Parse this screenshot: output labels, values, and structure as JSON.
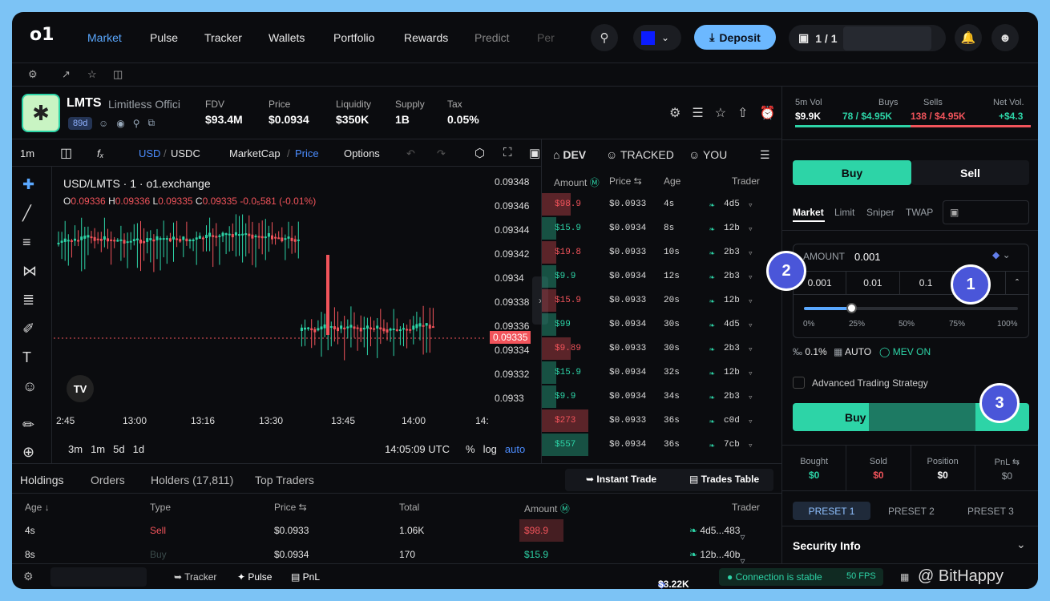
{
  "nav": {
    "logo": "o1",
    "items": [
      "Market",
      "Pulse",
      "Tracker",
      "Wallets",
      "Portfolio",
      "Rewards",
      "Predict",
      "Per"
    ],
    "deposit": "Deposit",
    "wallet": "1 / 1"
  },
  "token": {
    "ticker": "LMTS",
    "name": "Limitless Offici",
    "age": "89d",
    "fdv_label": "FDV",
    "fdv": "$93.4M",
    "price_label": "Price",
    "price": "$0.0934",
    "liq_label": "Liquidity",
    "liq": "$350K",
    "supply_label": "Supply",
    "supply": "1B",
    "tax_label": "Tax",
    "tax": "0.05%"
  },
  "chart_toolbar": {
    "interval": "1m",
    "usd": "USD",
    "usdc": "USDC",
    "marketcap": "MarketCap",
    "price": "Price",
    "options": "Options"
  },
  "chart": {
    "title": "USD/LMTS · 1 · o1.exchange",
    "ohlc": "O0.09336 H0.09336 L0.09335 C0.09335 -0.0₅581 (-0.01%)",
    "o_label": "O",
    "o": "0.09336",
    "h_label": "H",
    "h": "0.09336",
    "l_label": "L",
    "l": "0.09335",
    "c_label": "C",
    "c": "0.09335",
    "chg": "-0.0₅581 (-0.01%)",
    "current": "0.09335",
    "yticks": [
      "0.09348",
      "0.09346",
      "0.09344",
      "0.09342",
      "0.0934",
      "0.09338",
      "0.09336",
      "0.09334",
      "0.09332",
      "0.0933"
    ],
    "xticks": [
      "2:45",
      "13:00",
      "13:16",
      "13:30",
      "13:45",
      "14:00",
      "14:"
    ],
    "ranges": [
      "3m",
      "1m",
      "5d",
      "1d"
    ],
    "time": "14:05:09 UTC",
    "pct": "%",
    "log": "log",
    "auto": "auto"
  },
  "trade_tabs": {
    "dev": "DEV",
    "tracked": "TRACKED",
    "you": "YOU"
  },
  "trade_headers": {
    "amount": "Amount",
    "price": "Price",
    "age": "Age",
    "trader": "Trader"
  },
  "trades": [
    {
      "amount": "$98.9",
      "price": "$0.0933",
      "age": "4s",
      "trader": "4d5",
      "side": "sell"
    },
    {
      "amount": "$15.9",
      "price": "$0.0934",
      "age": "8s",
      "trader": "12b",
      "side": "buy"
    },
    {
      "amount": "$19.8",
      "price": "$0.0933",
      "age": "10s",
      "trader": "2b3",
      "side": "sell"
    },
    {
      "amount": "$9.9",
      "price": "$0.0934",
      "age": "12s",
      "trader": "2b3",
      "side": "buy"
    },
    {
      "amount": "$15.9",
      "price": "$0.0933",
      "age": "20s",
      "trader": "12b",
      "side": "sell"
    },
    {
      "amount": "$99",
      "price": "$0.0934",
      "age": "30s",
      "trader": "4d5",
      "side": "buy"
    },
    {
      "amount": "$9.89",
      "price": "$0.0933",
      "age": "30s",
      "trader": "2b3",
      "side": "sell"
    },
    {
      "amount": "$15.9",
      "price": "$0.0934",
      "age": "32s",
      "trader": "12b",
      "side": "buy"
    },
    {
      "amount": "$9.9",
      "price": "$0.0934",
      "age": "34s",
      "trader": "2b3",
      "side": "buy"
    },
    {
      "amount": "$273",
      "price": "$0.0933",
      "age": "36s",
      "trader": "c0d",
      "side": "sell"
    },
    {
      "amount": "$557",
      "price": "$0.0934",
      "age": "36s",
      "trader": "7cb",
      "side": "buy"
    }
  ],
  "bottom": {
    "tabs": [
      "Holdings",
      "Orders",
      "Holders (17,811)",
      "Top Traders"
    ],
    "instant": "Instant Trade",
    "table": "Trades Table",
    "headers": [
      "Age",
      "Type",
      "Price",
      "Total",
      "Amount",
      "Trader"
    ],
    "rows": [
      {
        "age": "4s",
        "type": "Sell",
        "price": "$0.0933",
        "total": "1.06K",
        "amount": "$98.9",
        "trader": "4d5...483"
      },
      {
        "age": "8s",
        "type": "Buy",
        "price": "$0.0934",
        "total": "170",
        "amount": "$15.9",
        "trader": "12b...40b"
      }
    ]
  },
  "footer": {
    "tracker": "Tracker",
    "pulse": "Pulse",
    "pnl": "PnL",
    "balance": "$3.22K",
    "status": "Connection is stable",
    "fps": "50 FPS",
    "watermark": "@ BitHappy"
  },
  "panel": {
    "vol_label": "5m Vol",
    "vol": "$9.9K",
    "buys_label": "Buys",
    "buys": "78 / $4.95K",
    "sells_label": "Sells",
    "sells": "138 / $4.95K",
    "net_label": "Net Vol.",
    "net": "+$4.3",
    "buy": "Buy",
    "sell": "Sell",
    "order_types": [
      "Market",
      "Limit",
      "Sniper",
      "TWAP"
    ],
    "amount_label": "AMOUNT",
    "amount": "0.001",
    "presets": [
      "0.001",
      "0.01",
      "0.1",
      "1"
    ],
    "slider": [
      "0%",
      "25%",
      "50%",
      "75%",
      "100%"
    ],
    "slippage": "0.1%",
    "auto": "AUTO",
    "mev": "MEV ON",
    "adv": "Advanced Trading Strategy",
    "buy_btn": "Buy",
    "bought_label": "Bought",
    "bought": "$0",
    "sold_label": "Sold",
    "sold": "$0",
    "position_label": "Position",
    "position": "$0",
    "pnl_label": "PnL",
    "pnl": "$0",
    "preset_tabs": [
      "PRESET 1",
      "PRESET 2",
      "PRESET 3"
    ],
    "security": "Security Info"
  },
  "badges": [
    "1",
    "2",
    "3"
  ],
  "colors": {
    "green": "#2dd4a7",
    "red": "#f2545b",
    "accent": "#5aa8ff"
  }
}
